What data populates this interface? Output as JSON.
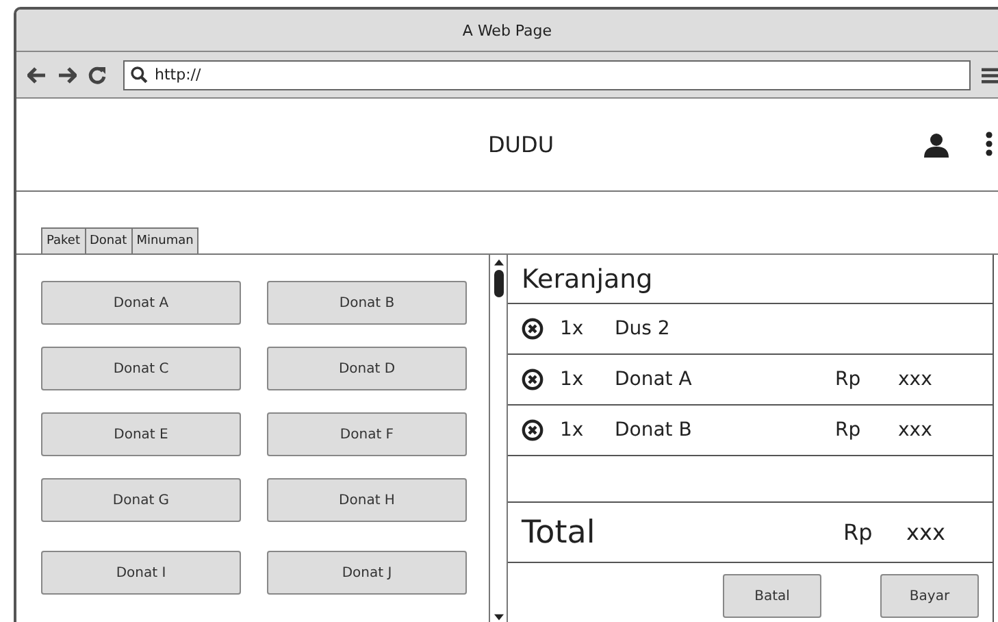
{
  "window": {
    "title": "A Web Page"
  },
  "browser": {
    "url": "http://"
  },
  "header": {
    "title": "DUDU"
  },
  "tabs": [
    {
      "label": "Paket",
      "selected": false
    },
    {
      "label": "Donat",
      "selected": false
    },
    {
      "label": "Minuman",
      "selected": false
    }
  ],
  "products": [
    "Donat A",
    "Donat B",
    "Donat C",
    "Donat D",
    "Donat E",
    "Donat F",
    "Donat G",
    "Donat H",
    "Donat I",
    "Donat J"
  ],
  "cart": {
    "title": "Keranjang",
    "items": [
      {
        "qty": "1x",
        "name": "Dus 2"
      },
      {
        "qty": "1x",
        "name": "Donat A",
        "currency": "Rp",
        "price": "xxx"
      },
      {
        "qty": "1x",
        "name": "Donat B",
        "currency": "Rp",
        "price": "xxx"
      }
    ],
    "total": {
      "label": "Total",
      "currency": "Rp",
      "amount": "xxx"
    },
    "buttons": [
      "Batal",
      "Bayar"
    ]
  }
}
